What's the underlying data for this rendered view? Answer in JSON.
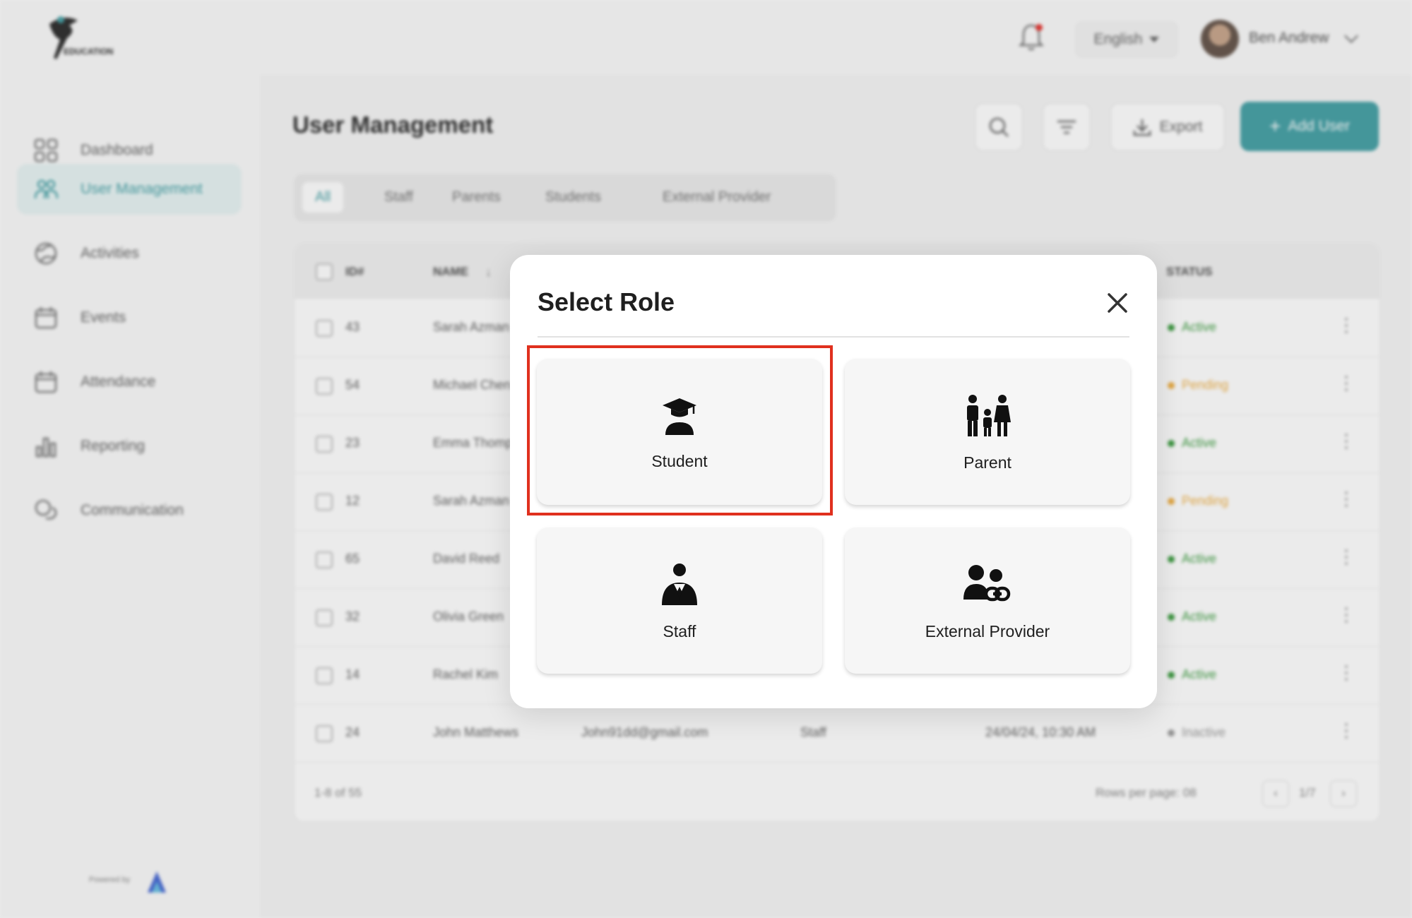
{
  "topbar": {
    "logo_text": "EDUCATION",
    "language": "English",
    "user_name": "Ben Andrew"
  },
  "sidebar": {
    "items": [
      {
        "label": "Dashboard",
        "icon": "grid-icon"
      },
      {
        "label": "User Management",
        "icon": "users-icon",
        "active": true
      },
      {
        "label": "Activities",
        "icon": "globe-icon"
      },
      {
        "label": "Events",
        "icon": "calendar-icon"
      },
      {
        "label": "Attendance",
        "icon": "calendar-check-icon"
      },
      {
        "label": "Reporting",
        "icon": "bar-chart-icon"
      },
      {
        "label": "Communication",
        "icon": "chat-icon"
      }
    ],
    "powered_by": "Powered by"
  },
  "main": {
    "title": "User Management",
    "export_label": "Export",
    "add_user_label": "Add User",
    "tabs": [
      "All",
      "Staff",
      "Parents",
      "Students",
      "External Provider"
    ],
    "table": {
      "headers": {
        "id": "ID#",
        "name": "NAME",
        "status": "STATUS"
      },
      "rows": [
        {
          "id": "43",
          "name": "Sarah Azman",
          "status": "Active"
        },
        {
          "id": "54",
          "name": "Michael Chen",
          "status": "Pending"
        },
        {
          "id": "23",
          "name": "Emma Thompson",
          "status": "Active"
        },
        {
          "id": "12",
          "name": "Sarah Azman",
          "status": "Pending"
        },
        {
          "id": "65",
          "name": "David Reed",
          "status": "Active"
        },
        {
          "id": "32",
          "name": "Olivia Green",
          "status": "Active"
        },
        {
          "id": "14",
          "name": "Rachel Kim",
          "status": "Active"
        },
        {
          "id": "24",
          "name": "John Matthews",
          "email": "John91dd@gmail.com",
          "role": "Staff",
          "date": "24/04/24, 10:30 AM",
          "status": "Inactive"
        }
      ],
      "range_text": "1-8 of 55",
      "rows_per_page": "Rows per page: 08",
      "page": "1/7"
    }
  },
  "modal": {
    "title": "Select Role",
    "roles": [
      {
        "label": "Student",
        "icon": "graduate-icon"
      },
      {
        "label": "Parent",
        "icon": "family-icon"
      },
      {
        "label": "Staff",
        "icon": "staff-icon"
      },
      {
        "label": "External Provider",
        "icon": "provider-link-icon"
      }
    ]
  },
  "colors": {
    "accent": "#4aa3a8",
    "highlight": "#e0301e",
    "active": "#43a047",
    "pending": "#f0b24a",
    "inactive": "#9e9e9e"
  }
}
